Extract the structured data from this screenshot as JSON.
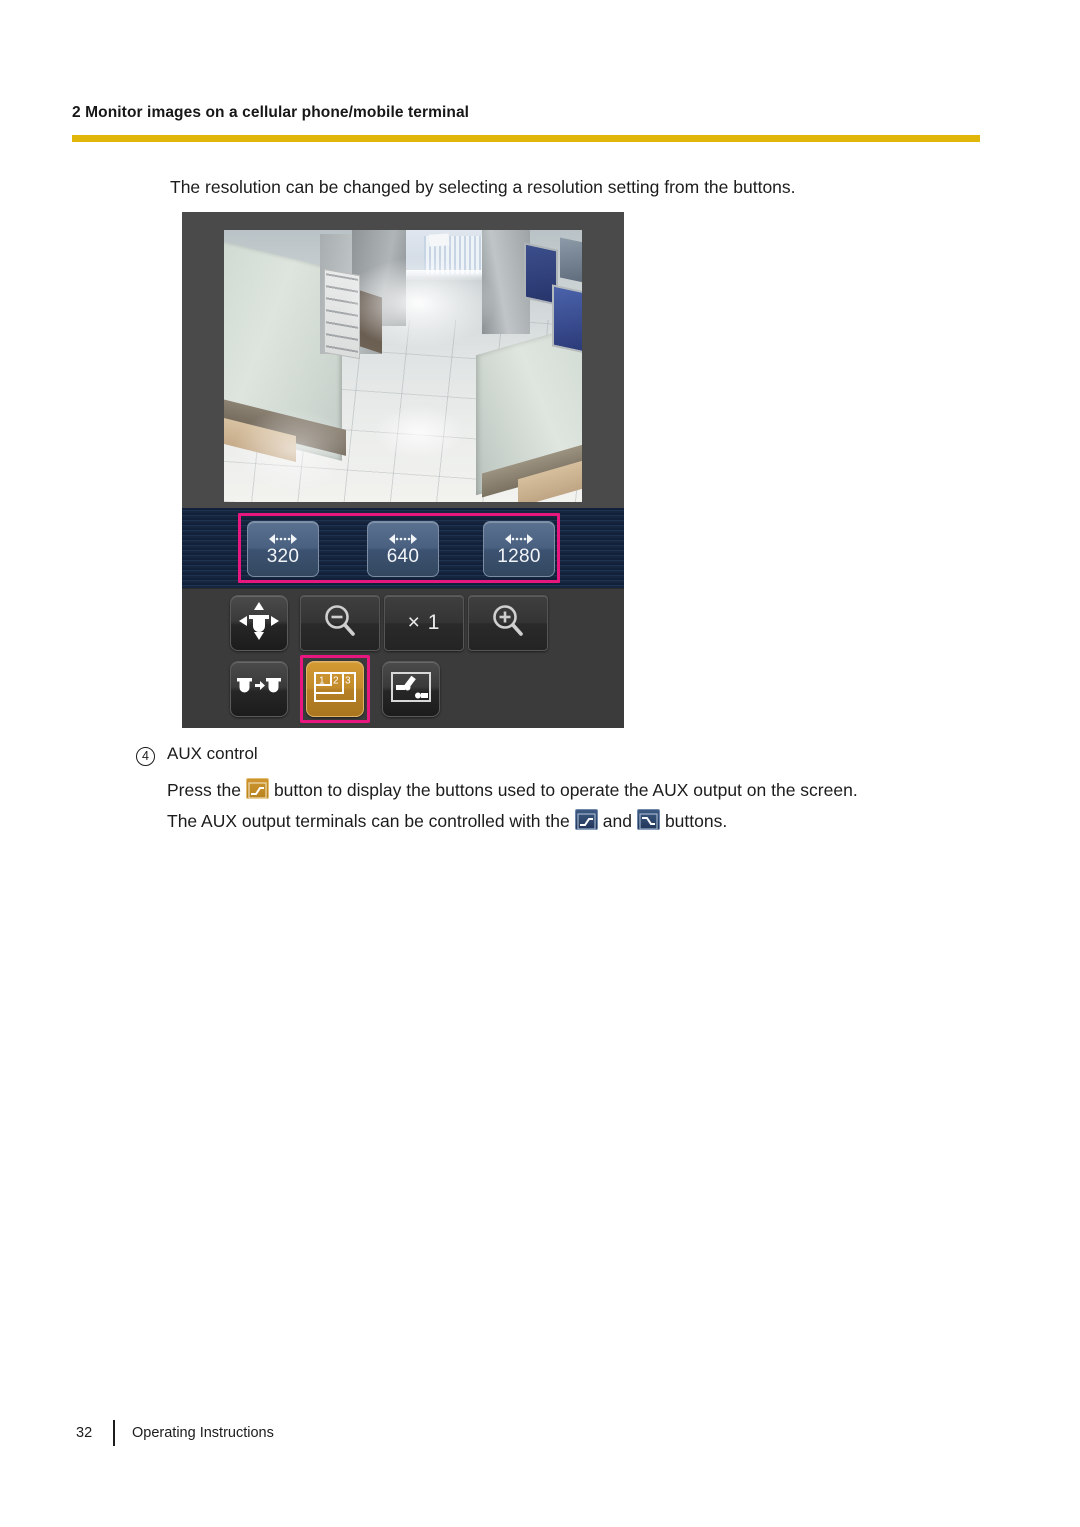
{
  "page": {
    "chapter_title": "2 Monitor images on a cellular phone/mobile terminal",
    "rule_color": "#e0b609",
    "intro_text": "The resolution can be changed by selecting a resolution setting from the buttons.",
    "footer": {
      "page_number": "32",
      "label": "Operating Instructions"
    }
  },
  "device_screenshot": {
    "name": "mobile-camera-control-screen",
    "video": {
      "scene": "indoor store aisle with tiled floor, glass display counters and monitors"
    },
    "highlight_color": "#e8177f",
    "resolution_buttons": [
      {
        "name": "resolution-320-button",
        "value": "320",
        "icon": "double-arrow-icon"
      },
      {
        "name": "resolution-640-button",
        "value": "640",
        "icon": "double-arrow-icon"
      },
      {
        "name": "resolution-1280-button",
        "value": "1280",
        "icon": "double-arrow-icon"
      }
    ],
    "control_buttons": [
      {
        "name": "pan-tilt-button",
        "icon": "pan-tilt-icon",
        "label": ""
      },
      {
        "name": "zoom-out-button",
        "icon": "zoom-out-icon",
        "label": ""
      },
      {
        "name": "zoom-reset-button",
        "icon": "zoom-reset-icon",
        "label": "× 1"
      },
      {
        "name": "zoom-in-button",
        "icon": "zoom-in-icon",
        "label": ""
      },
      {
        "name": "preset-button",
        "icon": "camera-switch-icon",
        "label": ""
      },
      {
        "name": "image-size-button",
        "icon": "image-size-123-icon",
        "label": "",
        "selected": true
      },
      {
        "name": "aux-button",
        "icon": "aux-switch-icon",
        "label": ""
      }
    ],
    "image_size_icon_labels": [
      "1",
      "2",
      "3"
    ]
  },
  "item": {
    "number": "4",
    "title": "AUX control",
    "line1_part1": "Press the",
    "line1_part2": "button to display the buttons used to operate the AUX output on the screen.",
    "line2_part1": "The AUX output terminals can be controlled with the",
    "line2_part2": "and",
    "line2_part3": "buttons.",
    "icons": {
      "aux_menu": "aux-open-orange-icon",
      "aux_open": "aux-open-blue-icon",
      "aux_close": "aux-close-blue-icon"
    }
  }
}
